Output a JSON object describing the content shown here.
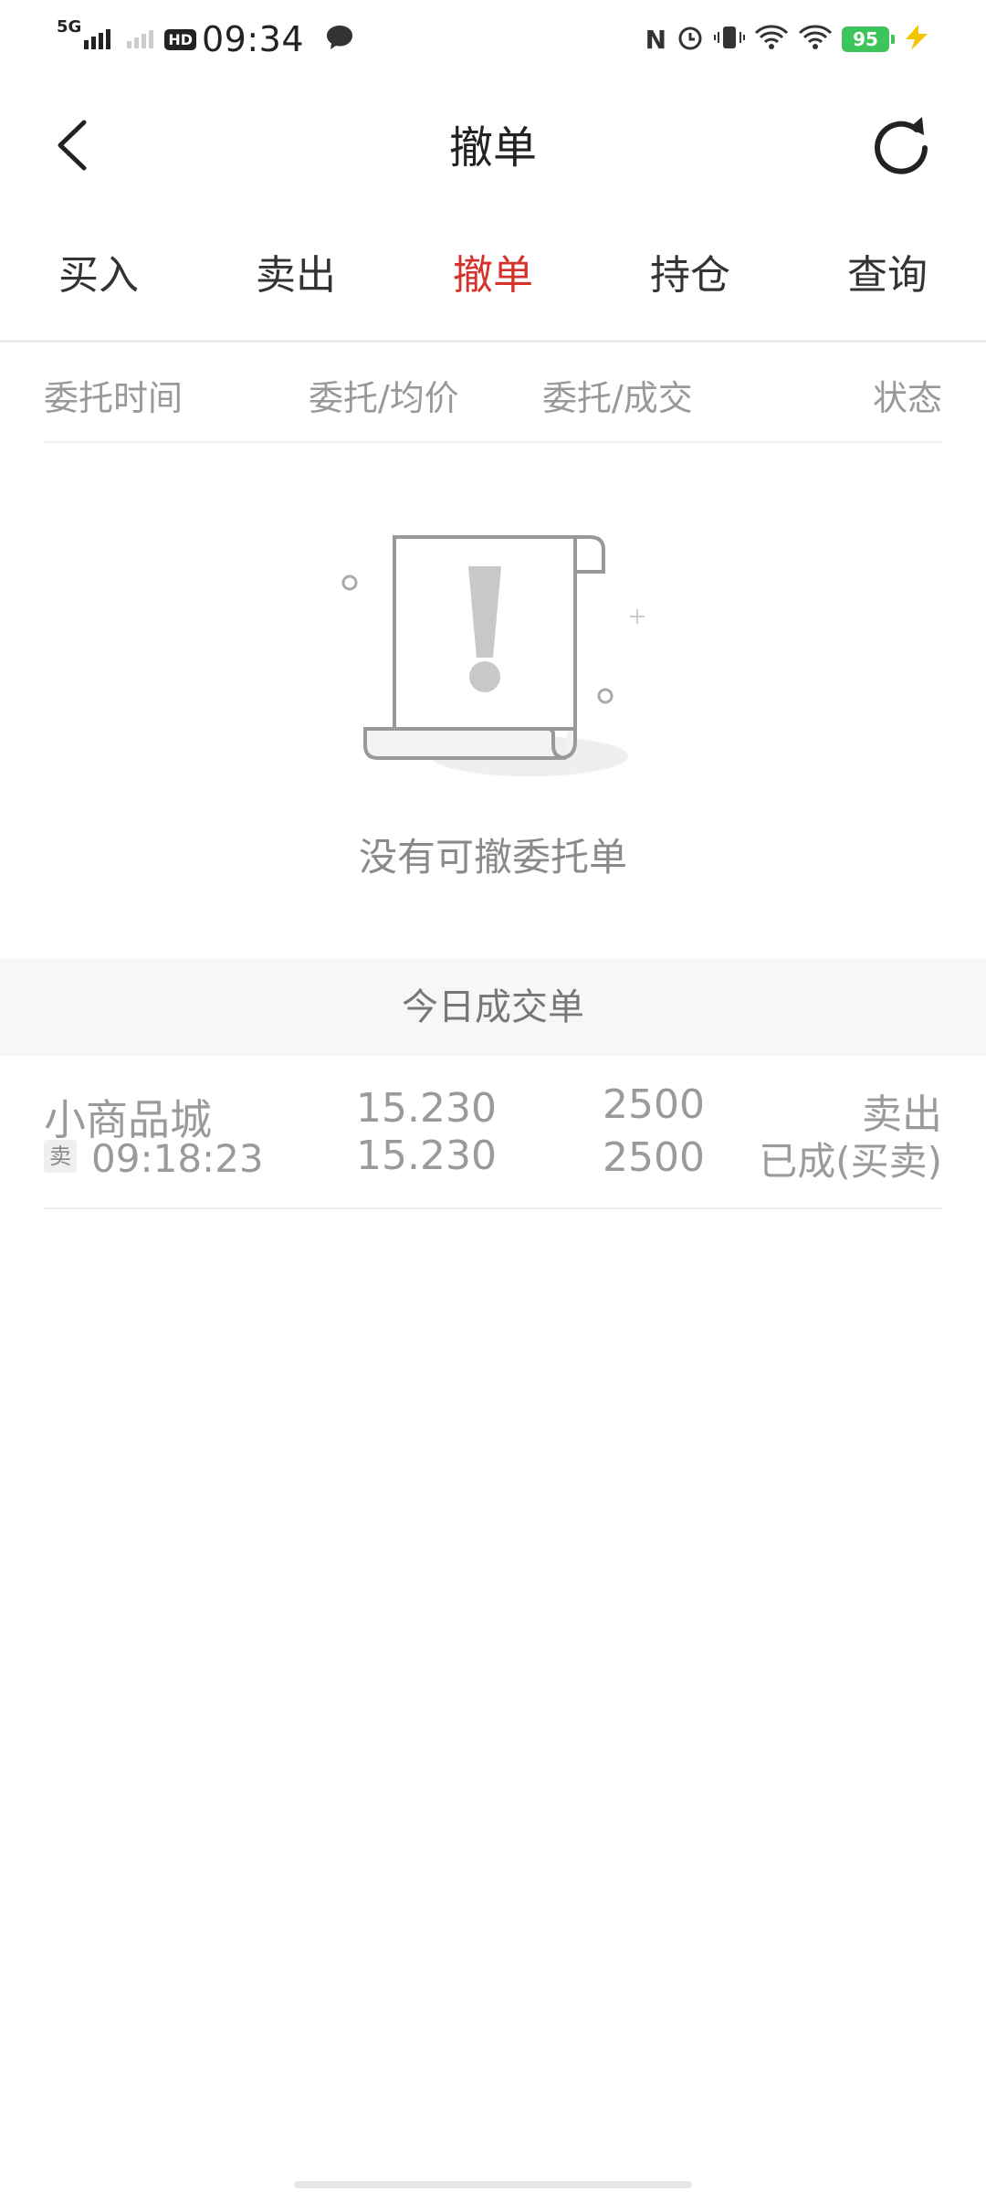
{
  "status_bar": {
    "network": "5G",
    "hd": "HD",
    "time": "09:34",
    "battery": "95",
    "accent": "#3dc45a"
  },
  "header": {
    "title": "撤单"
  },
  "tabs": [
    {
      "label": "买入"
    },
    {
      "label": "卖出"
    },
    {
      "label": "撤单",
      "active": true
    },
    {
      "label": "持仓"
    },
    {
      "label": "查询"
    }
  ],
  "columns": [
    "委托时间",
    "委托/均价",
    "委托/成交",
    "状态"
  ],
  "empty_state": {
    "message": "没有可撤委托单"
  },
  "today_section": {
    "title": "今日成交单"
  },
  "trades": [
    {
      "name": "小商品城",
      "side_badge": "卖",
      "time": "09:18:23",
      "order_price": "15.230",
      "avg_price": "15.230",
      "order_qty": "2500",
      "filled_qty": "2500",
      "direction": "卖出",
      "status": "已成(买卖)"
    }
  ],
  "colors": {
    "active_tab": "#d6322c",
    "muted_text": "#999999",
    "section_bg": "#f7f7f7"
  }
}
